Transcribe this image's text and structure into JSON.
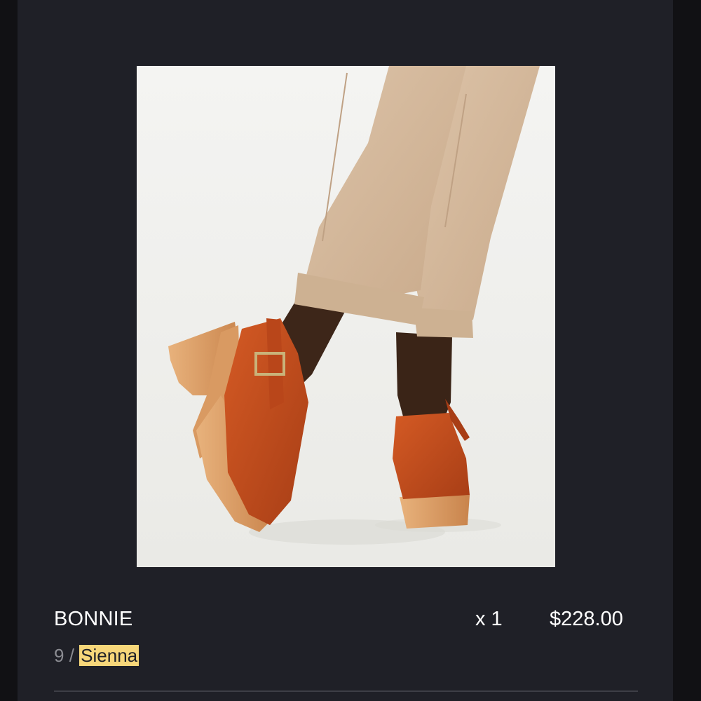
{
  "product": {
    "name": "BONNIE",
    "quantity_label": "x 1",
    "price": "$228.00",
    "size": "9",
    "variant_separator": "/",
    "color_name": "Sienna"
  },
  "colors": {
    "page_background": "#111114",
    "panel_background": "#1f2027",
    "highlight": "#f7d77a",
    "shoe_leather": "#c8501f",
    "wood_heel": "#d99a62",
    "trousers": "#d7bb9f"
  },
  "icons": {
    "product_image": "product-photo-clogs"
  }
}
